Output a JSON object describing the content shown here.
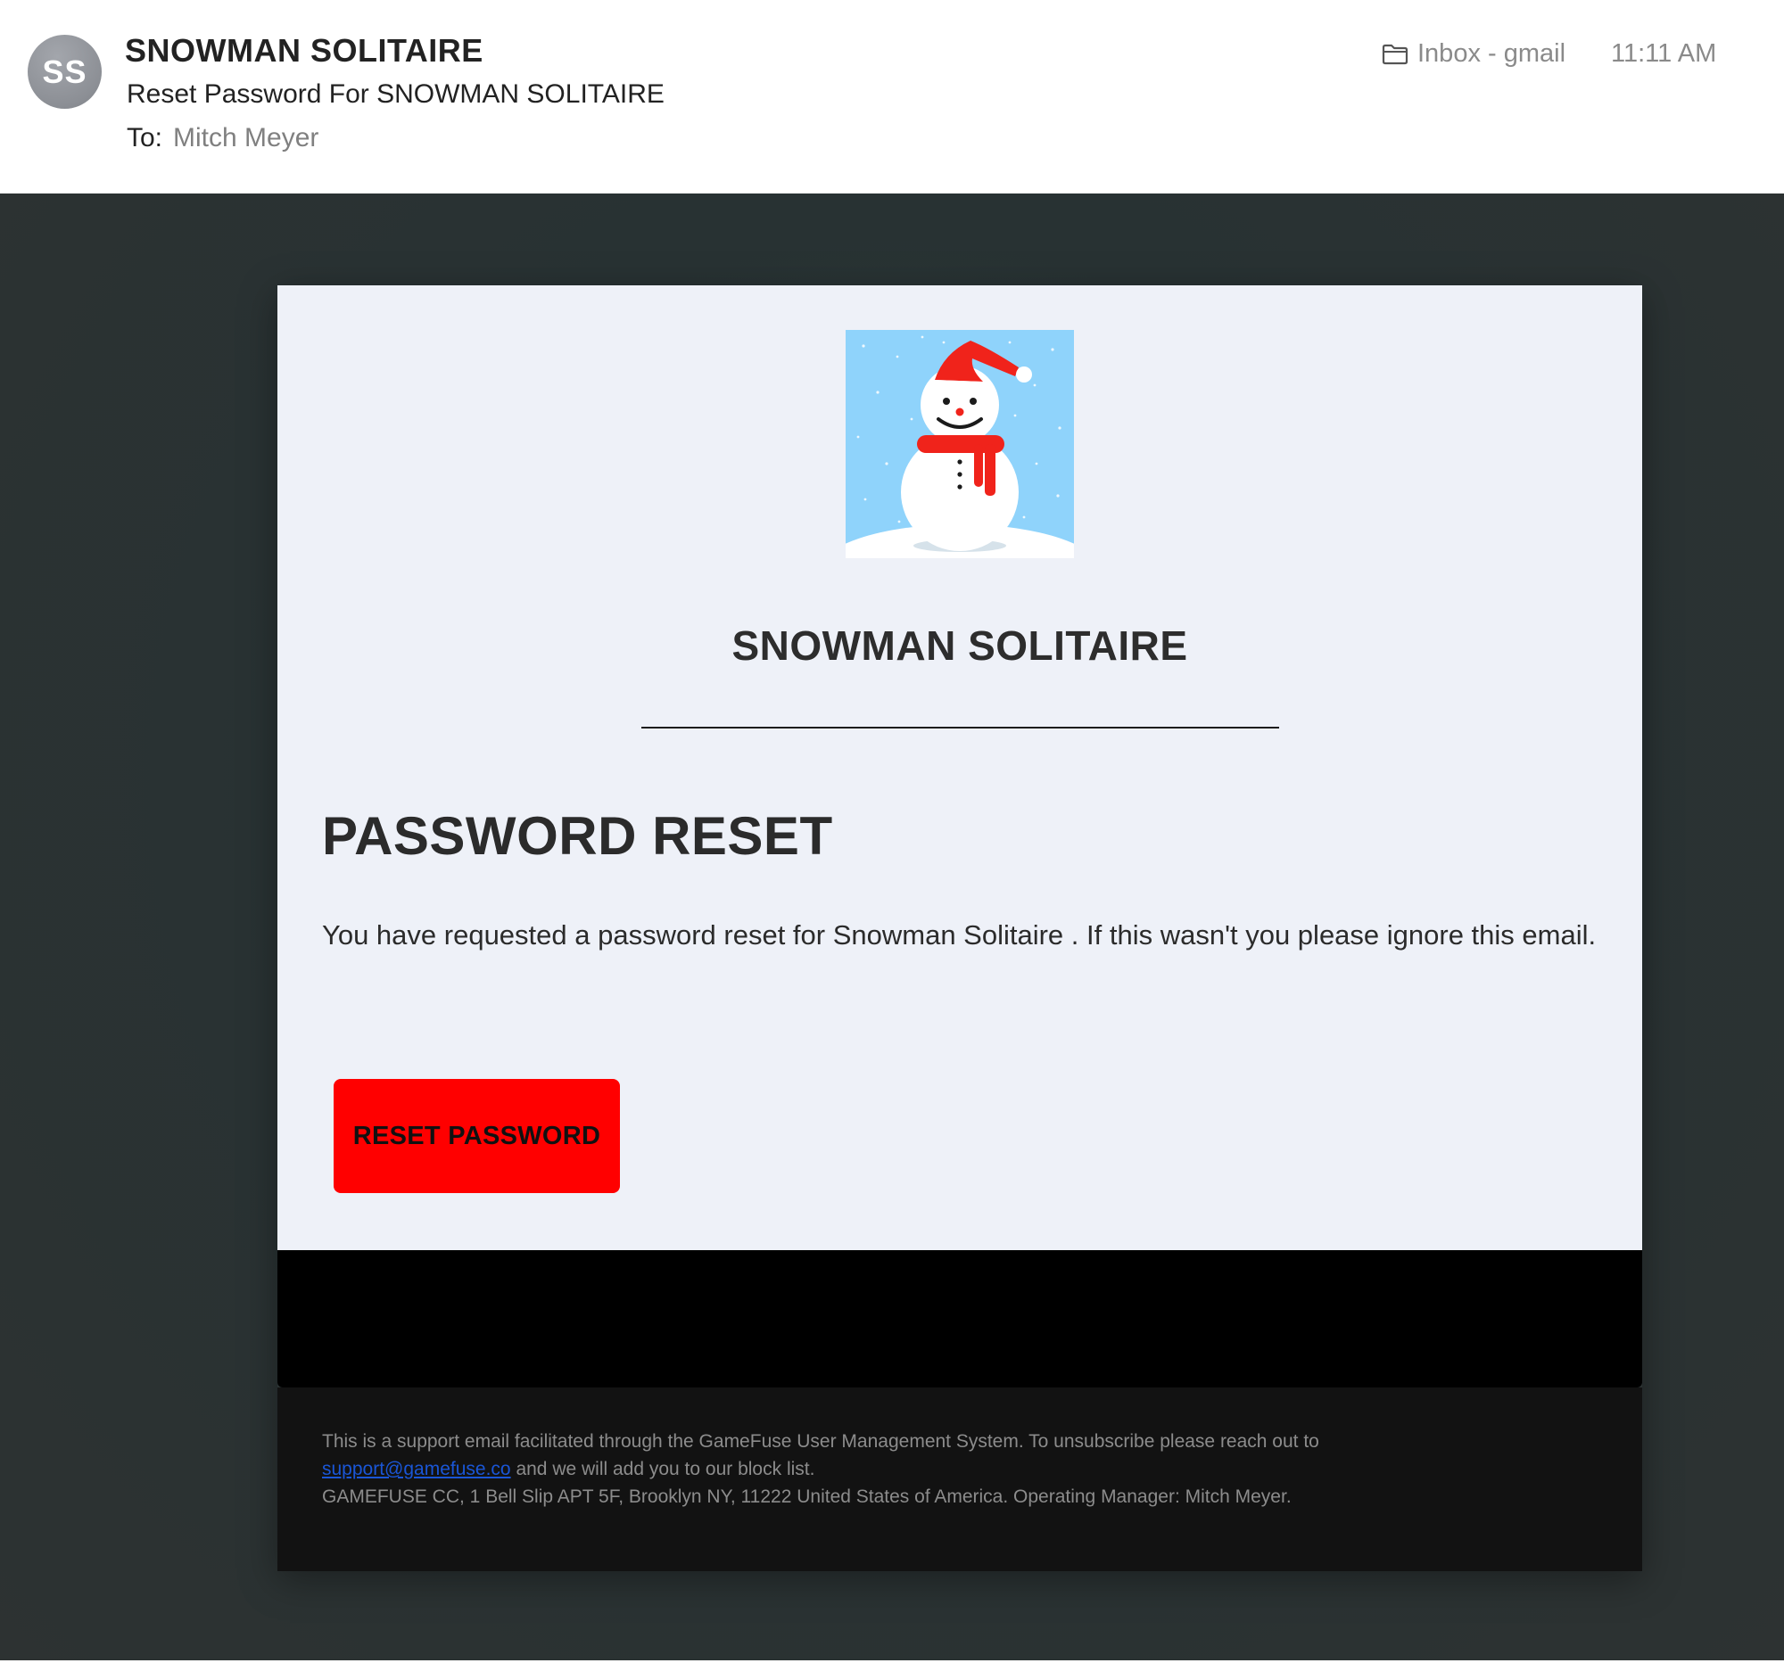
{
  "header": {
    "avatar_initials": "SS",
    "sender": "SNOWMAN SOLITAIRE",
    "subject": "Reset Password For SNOWMAN SOLITAIRE",
    "to_label": "To:",
    "to_name": "Mitch Meyer",
    "mailbox": "Inbox - gmail",
    "time": "11:11 AM",
    "icons": {
      "mailbox": "folder-icon"
    }
  },
  "email": {
    "logo": "snowman-logo",
    "brand_title": "SNOWMAN SOLITAIRE",
    "heading": "PASSWORD RESET",
    "body": "You have requested a password reset for Snowman Solitaire . If this wasn't you please ignore this email.",
    "button_label": "RESET PASSWORD",
    "footer": {
      "line1": "This is a support email facilitated through the GameFuse User Management System. To unsubscribe please reach out to",
      "link": "support@gamefuse.co",
      "line2_rest": " and we will add you to our block list.",
      "address": "GAMEFUSE CC, 1 Bell Slip APT 5F, Brooklyn NY, 11222 United States of America. Operating Manager: Mitch Meyer."
    }
  },
  "colors": {
    "button": "#ff0000",
    "card_background": "#eef1f8",
    "backdrop": "#283233",
    "link": "#1a56d6",
    "logo_sky": "#8fd3fb"
  }
}
